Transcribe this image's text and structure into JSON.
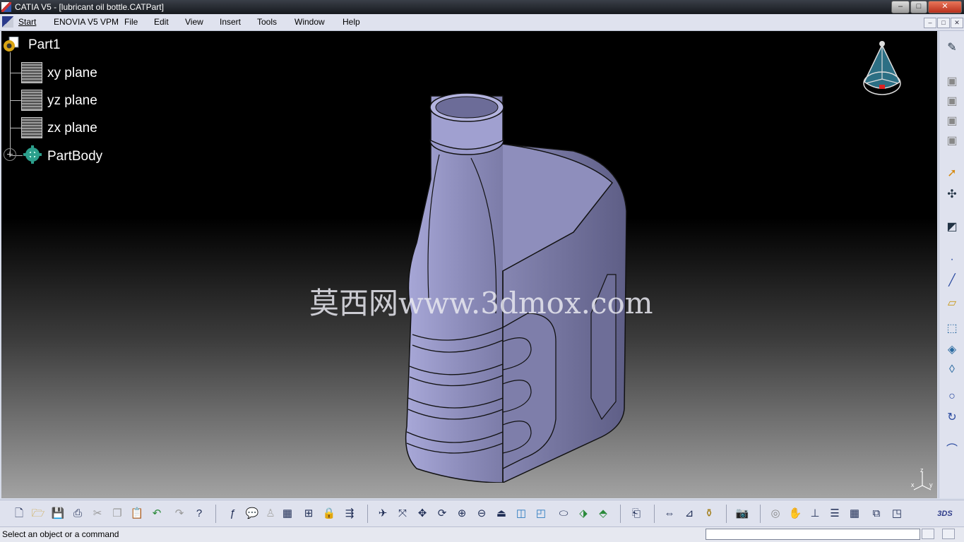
{
  "window": {
    "title": "CATIA V5 - [lubricant oil bottle.CATPart]",
    "min": "–",
    "max": "□",
    "close": "✕"
  },
  "menu": [
    "Start",
    "ENOVIA V5 VPM",
    "File",
    "Edit",
    "View",
    "Insert",
    "Tools",
    "Window",
    "Help"
  ],
  "tree": {
    "root": "Part1",
    "items": [
      "xy plane",
      "yz plane",
      "zx plane",
      "PartBody"
    ],
    "expand": "+"
  },
  "watermark": "莫西网www.3dmox.com",
  "compass_axes": {
    "x": "x",
    "y": "y",
    "z": "z"
  },
  "status": {
    "message": "Select an object or a command",
    "input_value": ""
  },
  "colors": {
    "accent": "#2f3c8a",
    "part": "#9a9ac8",
    "background_top": "#000000",
    "background_bottom": "#a3a3a3"
  },
  "right_toolbar_icons": [
    "sketcher",
    "select",
    "snap",
    "point",
    "line",
    "plane",
    "extrude",
    "revolve",
    "sweep",
    "circle",
    "spline",
    "curve"
  ],
  "bottom_toolbar_icons": [
    "new",
    "open",
    "save",
    "print",
    "cut",
    "copy",
    "paste",
    "undo",
    "redo",
    "whats-this",
    "formula",
    "comment",
    "knowledge",
    "table",
    "tree",
    "lock",
    "measure",
    "fly",
    "fit-all",
    "pan",
    "rotate",
    "zoom-in",
    "zoom-out",
    "normal-view",
    "iso-view",
    "shade",
    "hide",
    "swap",
    "render",
    "capture",
    "analysis",
    "snapshot",
    "settings",
    "hand",
    "axis",
    "spec",
    "grid",
    "section",
    "compass"
  ]
}
